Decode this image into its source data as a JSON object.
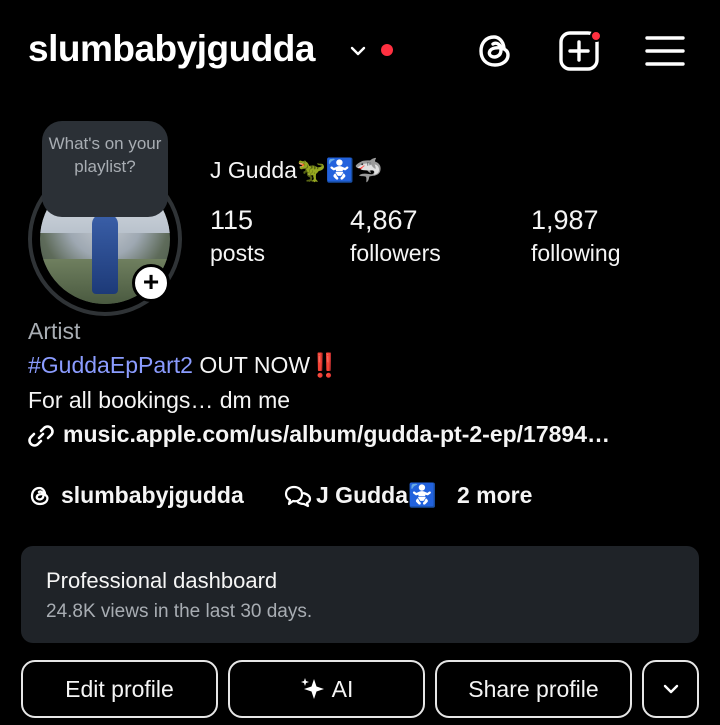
{
  "header": {
    "username": "slumbabyjgudda",
    "icons": [
      "chevron-down-icon",
      "threads-icon",
      "create-icon",
      "menu-icon"
    ],
    "notification_color": "#ff3040"
  },
  "avatar": {
    "note": "What's on your playlist?"
  },
  "profile": {
    "display_name": "J Gudda🦖🚼🦈",
    "stats": {
      "posts_count": "115",
      "posts_label": "posts",
      "followers_count": "4,867",
      "followers_label": "followers",
      "following_count": "1,987",
      "following_label": "following"
    }
  },
  "bio": {
    "category": "Artist",
    "hashtag": "#GuddaEpPart2",
    "line1_rest": " OUT NOW",
    "line1_emoji": "‼️",
    "line2": "For all bookings… dm me",
    "link": "music.apple.com/us/album/gudda-pt-2-ep/17894…",
    "threads_handle": "slumbabyjgudda",
    "linked_name": "J Gudda🚼",
    "more": "2 more"
  },
  "dashboard": {
    "title": "Professional dashboard",
    "subtitle": "24.8K views in the last 30 days."
  },
  "actions": {
    "edit_profile": "Edit profile",
    "ai": "AI",
    "share_profile": "Share profile"
  },
  "colors": {
    "background": "#000000",
    "hashtag": "#8b9cff",
    "dashboard_bg": "#1f2328"
  }
}
